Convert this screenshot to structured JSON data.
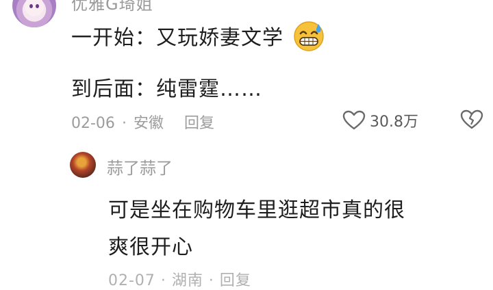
{
  "comment1": {
    "username": "优雅G琦姐",
    "lines": [
      "一开始：又玩娇妻文学",
      "到后面：纯雷霆……"
    ],
    "emoji": "grinning-sweat-emoji",
    "date": "02-06",
    "location": "安徽",
    "reply_label": "回复",
    "like_count": "30.8万"
  },
  "comment2": {
    "username": "蒜了蒜了",
    "lines": [
      "可是坐在购物车里逛超市真的很",
      "爽很开心"
    ],
    "bottom_partial": "02-07 · 湖南 · 回复"
  },
  "colors": {
    "meta": "#9c9c9c",
    "text": "#1e1e1e",
    "background": "#ffffff"
  }
}
